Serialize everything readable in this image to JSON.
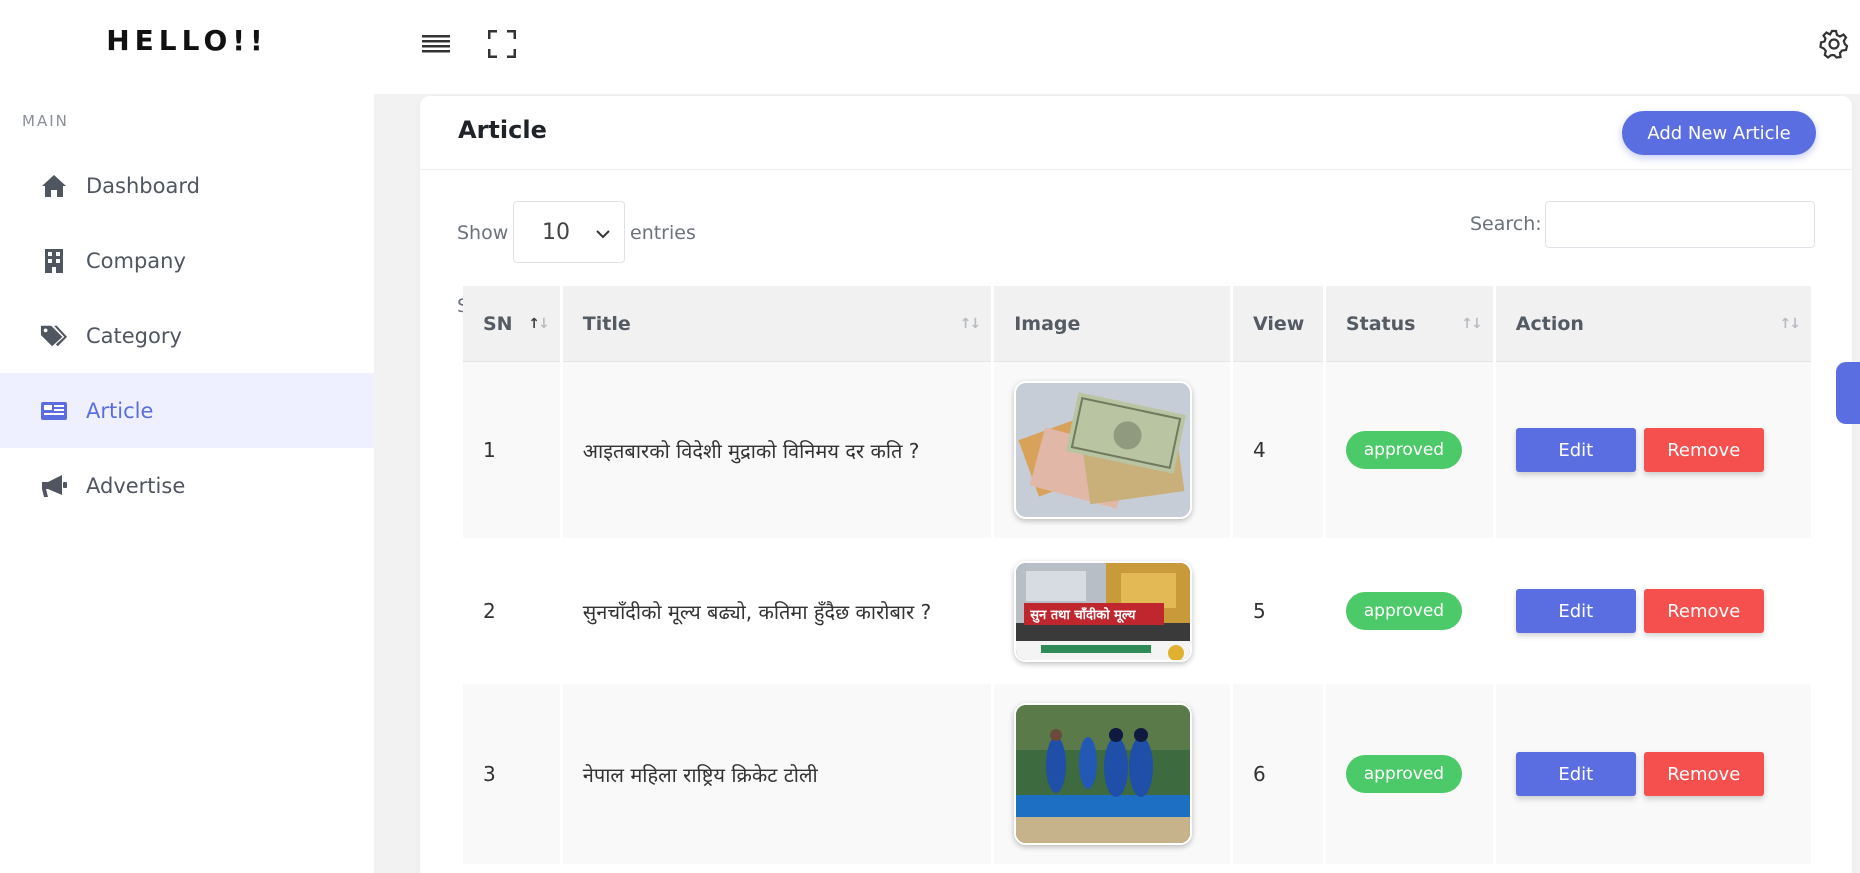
{
  "brand": "HELLO!!",
  "sidebar": {
    "section_label": "MAIN",
    "items": [
      {
        "label": "Dashboard",
        "icon": "home-icon"
      },
      {
        "label": "Company",
        "icon": "building-icon"
      },
      {
        "label": "Category",
        "icon": "tags-icon"
      },
      {
        "label": "Article",
        "icon": "newspaper-icon",
        "active": true
      },
      {
        "label": "Advertise",
        "icon": "megaphone-icon"
      }
    ]
  },
  "topbar": {
    "menu_icon": "hamburger-icon",
    "fullscreen_icon": "fullscreen-icon",
    "settings_icon": "gear-icon"
  },
  "card": {
    "title": "Article",
    "add_button": "Add New Article",
    "show_label": "Show",
    "entries_value": "10",
    "entries_label": "entries",
    "search_label": "Search:",
    "search_value": ""
  },
  "table": {
    "headers": [
      "SN",
      "Title",
      "Image",
      "View",
      "Status",
      "Action"
    ],
    "rows": [
      {
        "sn": "1",
        "title": "आइतबारको विदेशी मुद्राको विनिमय दर कति ?",
        "image": "currency-notes-image",
        "view": "4",
        "status": "approved",
        "edit": "Edit",
        "remove": "Remove"
      },
      {
        "sn": "2",
        "title": "सुनचाँदीको मूल्य बढ्यो, कतिमा हुँदैछ कारोबार ?",
        "image": "gold-silver-bars-image",
        "view": "5",
        "status": "approved",
        "edit": "Edit",
        "remove": "Remove",
        "image_text": "सुन तथा चाँदीको मूल्य"
      },
      {
        "sn": "3",
        "title": "नेपाल महिला राष्ट्रिय क्रिकेट टोली",
        "image": "cricket-team-image",
        "view": "6",
        "status": "approved",
        "edit": "Edit",
        "remove": "Remove"
      }
    ]
  },
  "colors": {
    "accent": "#5b6ee1",
    "success": "#4cc969",
    "danger": "#f5504d"
  }
}
